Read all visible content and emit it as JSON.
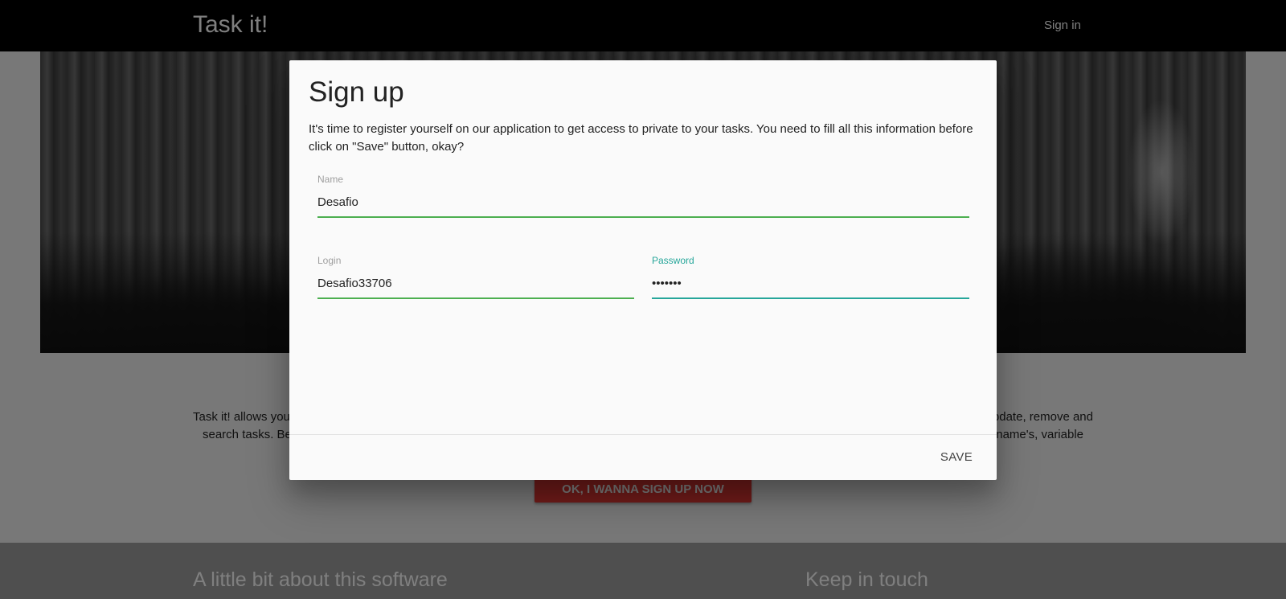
{
  "navbar": {
    "brand": "Task it!",
    "signin_label": "Sign in"
  },
  "about_section": {
    "line1": "Task it! allows you to create, update, remove and",
    "line2": "search tasks. Be ... name's, variable",
    "visible_left_1": "Task it! allows you",
    "visible_right_1": "pdate, remove and",
    "visible_left_2": "search tasks. Be",
    "visible_right_2": "name's, variable",
    "cta_label": "OK, I WANNA SIGN UP NOW"
  },
  "footer": {
    "about_title": "A little bit about this software",
    "touch_title": "Keep in touch"
  },
  "modal": {
    "title": "Sign up",
    "description": "It's time to register yourself on our application to get access to private to your tasks. You need to fill all this information before click on \"Save\" button, okay?",
    "name": {
      "label": "Name",
      "value": "Desafio"
    },
    "login": {
      "label": "Login",
      "value": "Desafio33706"
    },
    "password": {
      "label": "Password",
      "value": "•••••••"
    },
    "save_label": "SAVE"
  },
  "colors": {
    "accent_valid": "#4caf50",
    "accent_focus": "#26a69a",
    "cta": "#e53935"
  }
}
